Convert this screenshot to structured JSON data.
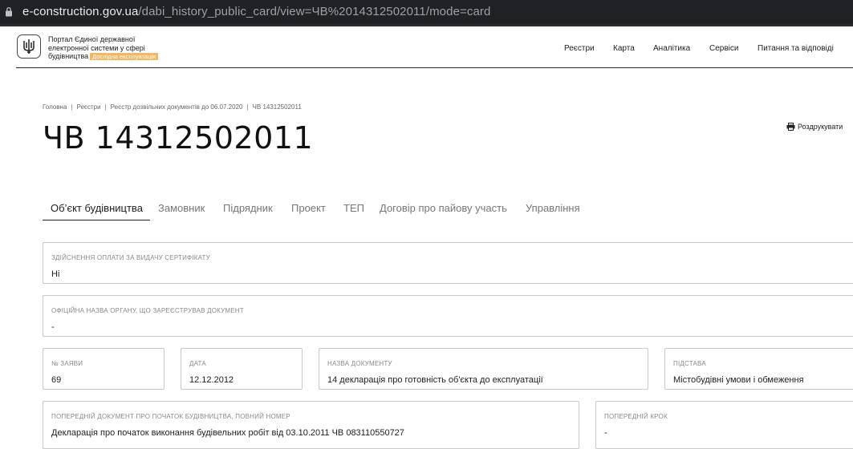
{
  "browser": {
    "url_host": "e-construction.gov.ua",
    "url_path": "/dabi_history_public_card/view=ЧВ%2014312502011/mode=card"
  },
  "header": {
    "portal_line1": "Портал Єдиної державної",
    "portal_line2": "електронної системи у сфері",
    "portal_line3": "будівництва",
    "badge": "Дослідна експлуатація",
    "nav": [
      "Реєстри",
      "Карта",
      "Аналітика",
      "Сервіси",
      "Питання та відповіді"
    ]
  },
  "breadcrumb": [
    "Головна",
    "Реєстри",
    "Реєстр дозвільних документів до 06.07.2020",
    "ЧВ 14312502011"
  ],
  "page": {
    "title": "ЧВ 14312502011",
    "print_label": "Роздрукувати"
  },
  "tabs": [
    "Об’єкт будівництва",
    "Замовник",
    "Підрядник",
    "Проект",
    "ТЕП",
    "Договір про пайову участь",
    "Управління"
  ],
  "fields": {
    "payment": {
      "label": "Здійснення оплати за видачу сертифікату",
      "value": "Ні"
    },
    "authority": {
      "label": "Офіційна назва органу, що зареєстрував документ",
      "value": "-"
    },
    "app_no": {
      "label": "№ заяви",
      "value": "69"
    },
    "date": {
      "label": "Дата",
      "value": "12.12.2012"
    },
    "doc_name": {
      "label": "Назва документу",
      "value": "14 декларація про готовність об'єкта до експлуатації"
    },
    "basis": {
      "label": "Підстава",
      "value": "Містобудівні умови і обмеження"
    },
    "prev_doc": {
      "label": "Попередній документ про початок будівництва, повний номер",
      "value": "Декларація про початок виконання будівельних робіт від 03.10.2011 ЧВ 083110550727"
    },
    "prev_step": {
      "label": "Попередній крок",
      "value": "-"
    }
  },
  "colors": {
    "badge": "#f2b764",
    "addressbar": "#202124"
  }
}
